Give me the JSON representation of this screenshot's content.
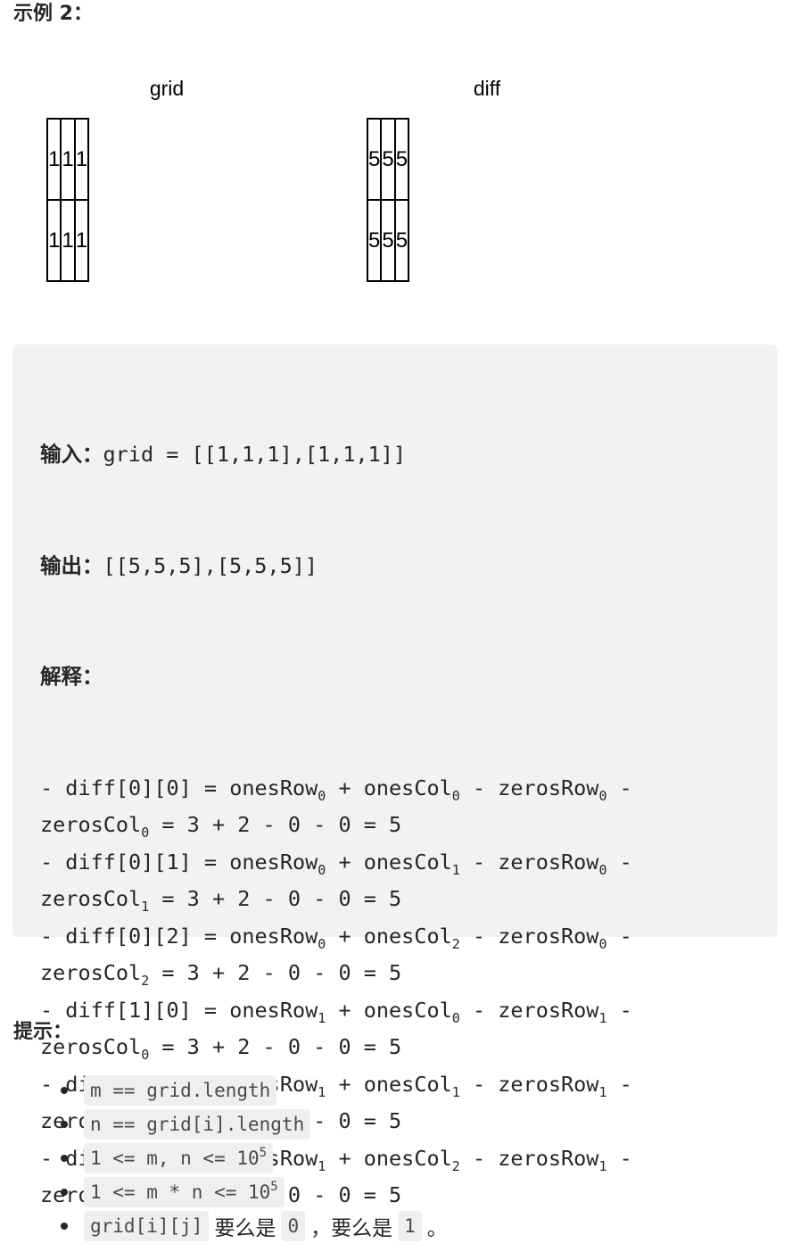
{
  "example": {
    "title": "示例 2："
  },
  "figure": {
    "grid": {
      "label": "grid",
      "rows": [
        [
          "1",
          "1",
          "1"
        ],
        [
          "1",
          "1",
          "1"
        ]
      ]
    },
    "diff": {
      "label": "diff",
      "rows": [
        [
          "5",
          "5",
          "5"
        ],
        [
          "5",
          "5",
          "5"
        ]
      ]
    }
  },
  "code": {
    "input_label": "输入：",
    "input_value": "grid = [[1,1,1],[1,1,1]]",
    "output_label": "输出：",
    "output_value": "[[5,5,5],[5,5,5]]",
    "explain_label": "解释：",
    "items": [
      {
        "head": "- diff[0][0] = onesRow",
        "r": "0",
        "c": "0"
      },
      {
        "head": "- diff[0][1] = onesRow",
        "r": "0",
        "c": "1"
      },
      {
        "head": "- diff[0][2] = onesRow",
        "r": "0",
        "c": "2"
      },
      {
        "head": "- diff[1][0] = onesRow",
        "r": "1",
        "c": "0"
      },
      {
        "head": "- diff[1][1] = onesRow",
        "r": "1",
        "c": "1"
      },
      {
        "head": "- diff[1][2] = onesRow",
        "r": "1",
        "c": "2"
      }
    ],
    "plus_onescol": " + onesCol",
    "minus_zerosrow": " - zerosRow",
    "trailing_minus": " -",
    "zeroscol": "zerosCol",
    "tail": " = 3 + 2 - 0 - 0 = 5"
  },
  "hints": {
    "title": "提示：",
    "items": [
      {
        "code": "m == grid.length"
      },
      {
        "code": "n == grid[i].length"
      },
      {
        "code_pre": "1 <= m, n <= 10",
        "sup": "5"
      },
      {
        "code_pre": "1 <= m * n <= 10",
        "sup": "5"
      },
      {
        "code": "grid[i][j]",
        "text1": "要么是",
        "code2": "0",
        "text2": "，要么是",
        "code3": "1",
        "text3": "。"
      }
    ]
  }
}
